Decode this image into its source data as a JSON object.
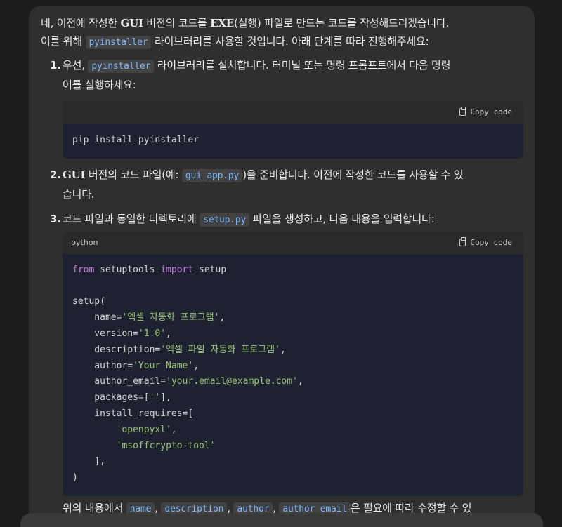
{
  "intro": {
    "line1_a": "네, 이전에 작성한 ",
    "line1_gui": "GUI",
    "line1_b": " 버전의 코드를 ",
    "line1_exe": "EXE",
    "line1_c": "(실행) 파일로 만드는 코드를 작성해드리겠습니다.",
    "line2_a": "이를 위해 ",
    "line2_code": "pyinstaller",
    "line2_b": " 라이브러리를 사용할 것입니다. 아래 단계를 따라 진행해주세요:"
  },
  "steps": [
    {
      "num": "1.",
      "text_a": "우선, ",
      "code": "pyinstaller",
      "text_b": " 라이브러리를 설치합니다. 터미널 또는 명령 프롬프트에서 다음 명령",
      "text_c": "어를 실행하세요:",
      "codeblock": {
        "lang": "",
        "copy_label": "Copy code",
        "line": "pip install pyinstaller"
      }
    },
    {
      "num": "2.",
      "gui": "GUI",
      "text_a": " 버전의 코드 파일(예: ",
      "code": "gui_app.py",
      "text_b": ")을 준비합니다. 이전에 작성한 코드를 사용할 수 있",
      "text_c": "습니다."
    },
    {
      "num": "3.",
      "text_a": "코드 파일과 동일한 디렉토리에 ",
      "code": "setup.py",
      "text_b": " 파일을 생성하고, 다음 내용을 입력합니다:",
      "codeblock": {
        "lang": "python",
        "copy_label": "Copy code",
        "l1_kw1": "from",
        "l1_mid": " setuptools ",
        "l1_kw2": "import",
        "l1_end": " setup",
        "l3": "setup(",
        "l4_k": "    name=",
        "l4_v": "'엑셀 자동화 프로그램'",
        "l5_k": "    version=",
        "l5_v": "'1.0'",
        "l6_k": "    description=",
        "l6_v": "'엑셀 파일 자동화 프로그램'",
        "l7_k": "    author=",
        "l7_v": "'Your Name'",
        "l8_k": "    author_email=",
        "l8_v": "'your.email@example.com'",
        "l9_k": "    packages=[",
        "l9_v": "''",
        "l9_e": "],",
        "l10": "    install_requires=[",
        "l11": "'openpyxl'",
        "l12": "'msoffcrypto-tool'",
        "l13": "    ],",
        "l14": ")"
      }
    }
  ],
  "after": {
    "text_a": "위의 내용에서 ",
    "c1": "name",
    "c2": "description",
    "c3": "author",
    "c4": "author_email",
    "text_b": "은 필요에 따라 수정할 수 있"
  }
}
